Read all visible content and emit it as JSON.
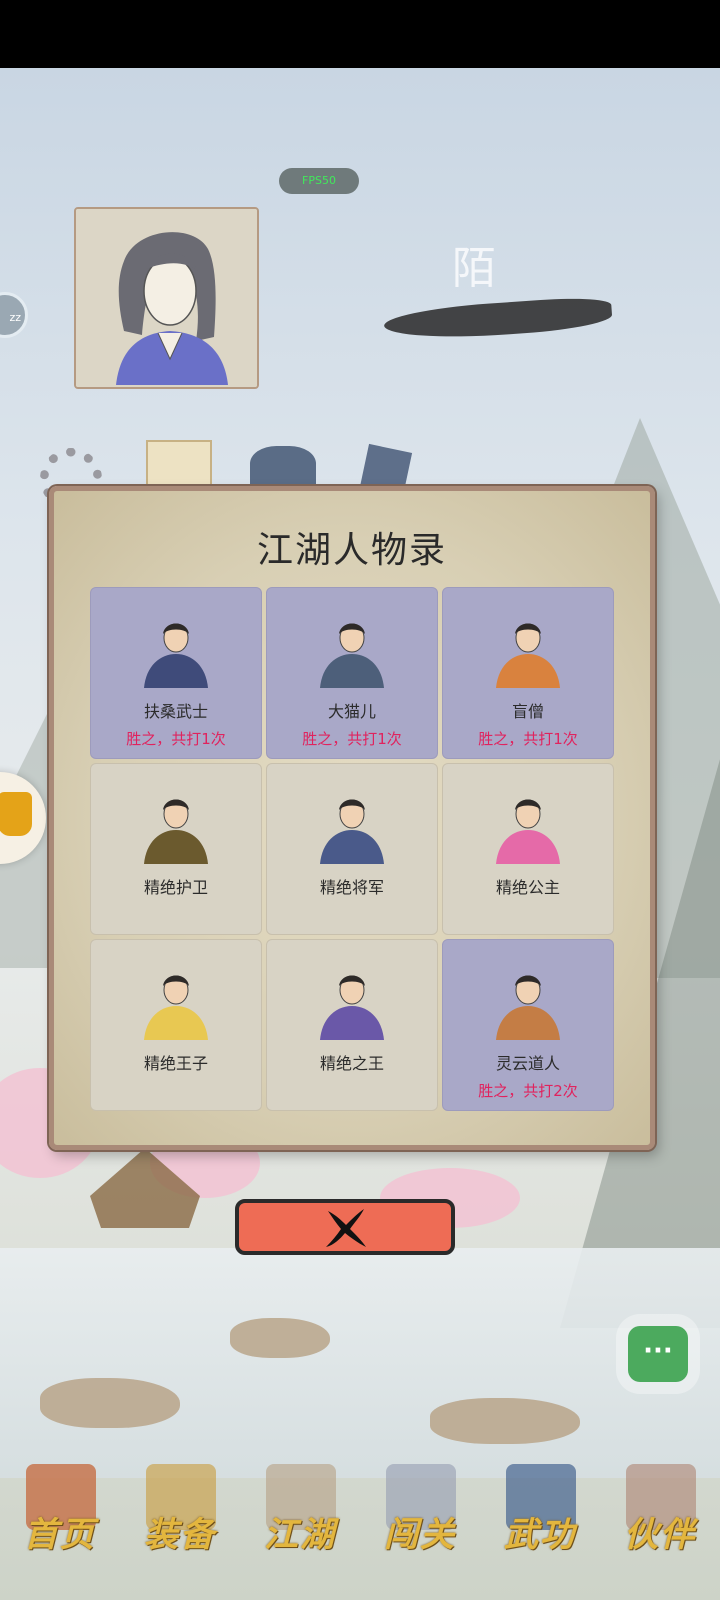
{
  "hud": {
    "fps_label": "FPS50",
    "player_name": "陌"
  },
  "dialog": {
    "title": "江湖人物录",
    "characters": [
      {
        "name": "扶桑武士",
        "record": "胜之，共打1次",
        "defeated": true
      },
      {
        "name": "大猫儿",
        "record": "胜之，共打1次",
        "defeated": true
      },
      {
        "name": "盲僧",
        "record": "胜之，共打1次",
        "defeated": true
      },
      {
        "name": "精绝护卫",
        "record": "",
        "defeated": false
      },
      {
        "name": "精绝将军",
        "record": "",
        "defeated": false
      },
      {
        "name": "精绝公主",
        "record": "",
        "defeated": false
      },
      {
        "name": "精绝王子",
        "record": "",
        "defeated": false
      },
      {
        "name": "精绝之王",
        "record": "",
        "defeated": false
      },
      {
        "name": "灵云道人",
        "record": "胜之，共打2次",
        "defeated": true
      }
    ],
    "close_icon": "x-brush-icon"
  },
  "nav": {
    "items": [
      {
        "label": "首页",
        "icon": "home-gate-icon",
        "active": true
      },
      {
        "label": "装备",
        "icon": "armor-icon",
        "active": false
      },
      {
        "label": "江湖",
        "icon": "scroll-map-icon",
        "active": false
      },
      {
        "label": "闯关",
        "icon": "crossed-swords-icon",
        "active": false
      },
      {
        "label": "武功",
        "icon": "martial-book-icon",
        "active": false
      },
      {
        "label": "伙伴",
        "icon": "companions-icon",
        "active": false
      }
    ]
  },
  "colors": {
    "defeated_cell": "#a9a8c8",
    "record_text": "#e0235e",
    "close_button": "#ee6c55",
    "nav_label": "#e3b63e"
  }
}
